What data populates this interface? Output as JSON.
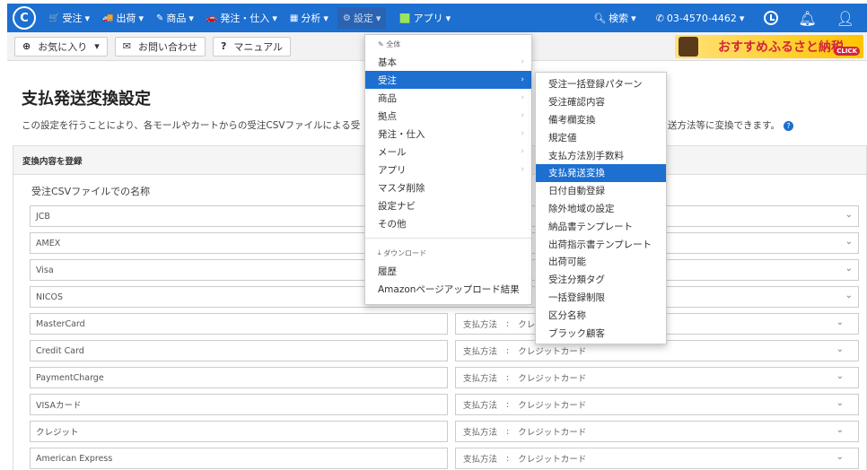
{
  "nav": {
    "logo": "C",
    "items": [
      {
        "icon": "🛒",
        "label": "受注"
      },
      {
        "icon": "🚚",
        "label": "出荷"
      },
      {
        "icon": "✎",
        "label": "商品"
      },
      {
        "icon": "🚗",
        "label": "発注・仕入"
      },
      {
        "icon": "▦",
        "label": "分析"
      },
      {
        "icon": "⚙",
        "label": "設定"
      },
      {
        "icon": "■",
        "label": "アプリ"
      }
    ],
    "search_label": "検索",
    "phone": "03-4570-4462"
  },
  "subbar": {
    "favorites": "お気に入り",
    "contact": "お問い合わせ",
    "manual": "マニュアル",
    "banner_text": "おすすめふるさと納税",
    "banner_click": "CLICK"
  },
  "page": {
    "title": "支払発送変換設定",
    "description": "この設定を行うことにより、各モールやカートからの受注CSVファイルによる受",
    "description_tail": "送方法等に変換できます。",
    "panel_header": "変換内容を登録",
    "field_label": "受注CSVファイルでの名称"
  },
  "rows_full": [
    "JCB",
    "AMEX",
    "Visa",
    "NICOS"
  ],
  "rows": [
    {
      "name": "MasterCard",
      "method_label": "支払方法",
      "sep": ":",
      "method": "クレ"
    },
    {
      "name": "Credit Card",
      "method_label": "支払方法",
      "sep": ":",
      "method": "クレジットカード"
    },
    {
      "name": "PaymentCharge",
      "method_label": "支払方法",
      "sep": ":",
      "method": "クレジットカード"
    },
    {
      "name": "VISAカード",
      "method_label": "支払方法",
      "sep": ":",
      "method": "クレジットカード"
    },
    {
      "name": "クレジット",
      "method_label": "支払方法",
      "sep": ":",
      "method": "クレジットカード"
    },
    {
      "name": "American Express",
      "method_label": "支払方法",
      "sep": ":",
      "method": "クレジットカード"
    }
  ],
  "menu": {
    "header_all": "全体",
    "items": [
      {
        "label": "基本",
        "arrow": "›"
      },
      {
        "label": "受注",
        "arrow": "›"
      },
      {
        "label": "商品",
        "arrow": "›"
      },
      {
        "label": "拠点",
        "arrow": "›"
      },
      {
        "label": "発注・仕入",
        "arrow": "›"
      },
      {
        "label": "メール",
        "arrow": "›"
      },
      {
        "label": "アプリ",
        "arrow": "›"
      },
      {
        "label": "マスタ削除",
        "arrow": ""
      },
      {
        "label": "設定ナビ",
        "arrow": ""
      },
      {
        "label": "その他",
        "arrow": ""
      }
    ],
    "header_download": "ダウンロード",
    "download_items": [
      "履歴",
      "Amazonページアップロード結果"
    ]
  },
  "submenu": {
    "items": [
      "受注一括登録パターン",
      "受注確認内容",
      "備考欄変換",
      "規定値",
      "支払方法別手数料",
      "支払発送変換",
      "日付自動登録",
      "除外地域の設定",
      "納品書テンプレート",
      "出荷指示書テンプレート",
      "出荷可能",
      "受注分類タグ",
      "一括登録制限",
      "区分名称",
      "ブラック顧客"
    ]
  }
}
